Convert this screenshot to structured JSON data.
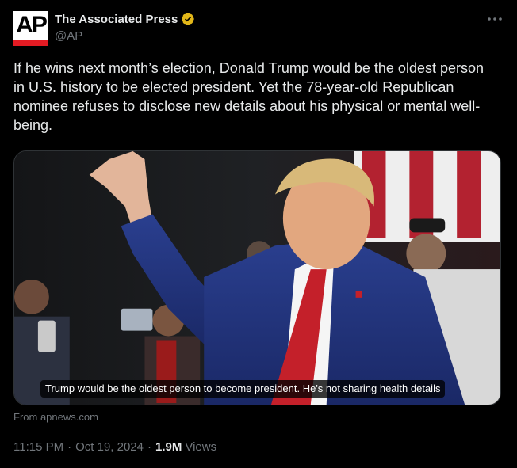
{
  "author": {
    "display_name": "The Associated Press",
    "handle": "@AP",
    "avatar_text": "AP",
    "verified_color": "#e2b719",
    "brand_red": "#e31b23"
  },
  "tweet": {
    "text": "If he wins next month’s election, Donald Trump would be the oldest person in U.S. history to be elected president. Yet the 78-year-old Republican nominee refuses to disclose new details about his physical or mental well-being."
  },
  "card": {
    "caption": "Trump would be the oldest person to become president. He's not sharing health details",
    "source": "From apnews.com"
  },
  "meta": {
    "time": "11:15 PM",
    "separator": "·",
    "date": "Oct 19, 2024",
    "views_count": "1.9M",
    "views_label": "Views"
  },
  "icons": {
    "more": "more-horizontal-icon",
    "verified": "verified-badge-icon"
  },
  "colors": {
    "background": "#000000",
    "text_primary": "#e7e9ea",
    "text_secondary": "#71767b",
    "border": "#2f3336"
  }
}
